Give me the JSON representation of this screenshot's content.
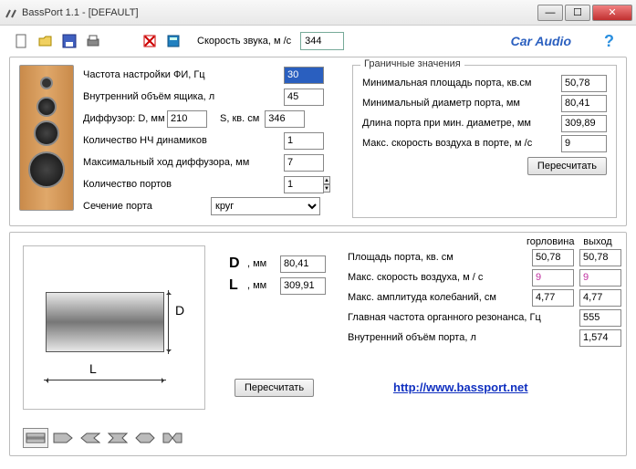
{
  "window": {
    "title": "BassPort 1.1 - [DEFAULT]"
  },
  "toolbar": {
    "sound_speed_label": "Скорость звука, м /с",
    "sound_speed": "344",
    "car_audio": "Car Audio",
    "help": "?"
  },
  "params": {
    "tune_freq_label": "Частота настройки ФИ, Гц",
    "tune_freq": "30",
    "box_vol_label": "Внутренний объём ящика, л",
    "box_vol": "45",
    "diff_label": "Диффузор: D, мм",
    "diff_d": "210",
    "diff_s_label": "S, кв. см",
    "diff_s": "346",
    "lf_count_label": "Количество НЧ динамиков",
    "lf_count": "1",
    "xmax_label": "Максимальный ход диффузора, мм",
    "xmax": "7",
    "port_count_label": "Количество портов",
    "port_count": "1",
    "section_label": "Сечение порта",
    "section": "круг"
  },
  "limits": {
    "legend": "Граничные значения",
    "min_area_label": "Минимальная площадь порта, кв.см",
    "min_area": "50,78",
    "min_diam_label": "Минимальный диаметр порта, мм",
    "min_diam": "80,41",
    "len_min_label": "Длина порта при мин. диаметре, мм",
    "len_min": "309,89",
    "max_vel_label": "Макс. скорость воздуха в порте, м /с",
    "max_vel": "9",
    "recalc": "Пересчитать"
  },
  "port": {
    "D_label": "D",
    "D_unit": ", мм",
    "D": "80,41",
    "L_label": "L",
    "L_unit": ", мм",
    "L": "309,91"
  },
  "results": {
    "hdr_throat": "горловина",
    "hdr_exit": "выход",
    "area_label": "Площадь порта, кв. см",
    "area_t": "50,78",
    "area_e": "50,78",
    "vel_label": "Макс. скорость воздуха, м / с",
    "vel_t": "9",
    "vel_e": "9",
    "amp_label": "Макс. амплитуда колебаний, см",
    "amp_t": "4,77",
    "amp_e": "4,77",
    "organ_label": "Главная частота органного резонанса, Гц",
    "organ": "555",
    "pvol_label": "Внутренний объём порта, л",
    "pvol": "1,574",
    "recalc": "Пересчитать",
    "link": "http://www.bassport.net"
  },
  "icons": {
    "new": "new-icon",
    "open": "open-icon",
    "save": "save-icon",
    "print": "print-icon",
    "delete": "delete-icon",
    "calc": "calc-icon"
  }
}
